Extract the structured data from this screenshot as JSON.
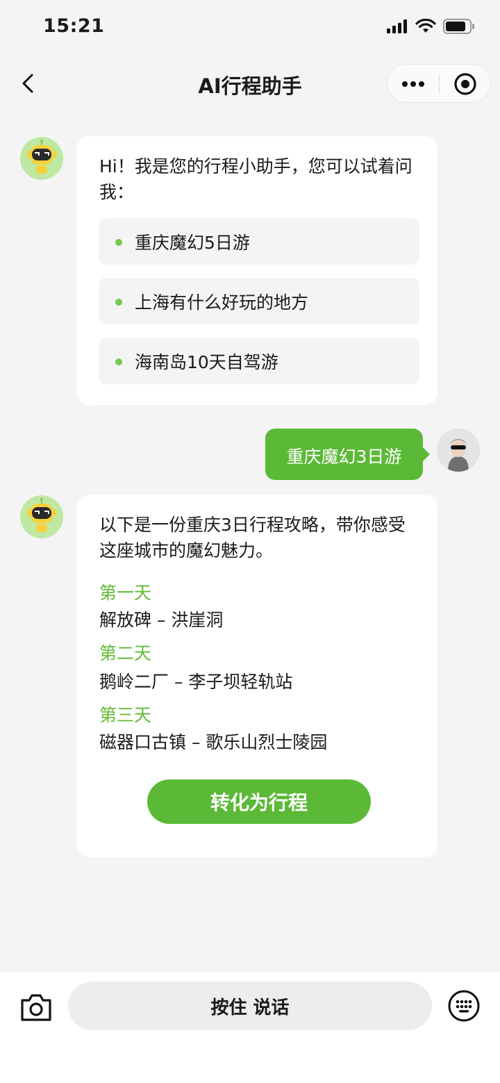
{
  "status_bar": {
    "time": "15:21"
  },
  "nav": {
    "title": "AI行程助手"
  },
  "greeting": {
    "text": "Hi！我是您的行程小助手，您可以试着问我：",
    "suggestions": [
      "重庆魔幻5日游",
      "上海有什么好玩的地方",
      "海南岛10天自驾游"
    ]
  },
  "user_message": {
    "text": "重庆魔幻3日游"
  },
  "reply": {
    "intro": "以下是一份重庆3日行程攻略，带你感受这座城市的魔幻魅力。",
    "days": [
      {
        "label": "第一天",
        "route": "解放碑 – 洪崖洞"
      },
      {
        "label": "第二天",
        "route": "鹅岭二厂 – 李子坝轻轨站"
      },
      {
        "label": "第三天",
        "route": "磁器口古镇 – 歌乐山烈士陵园"
      }
    ],
    "convert_button": "转化为行程"
  },
  "bottom_bar": {
    "hold_to_talk": "按住 说话"
  },
  "colors": {
    "accent": "#5cb937",
    "day_label": "#62bb38",
    "background": "#f4f4f4"
  },
  "icons": {
    "bot_avatar": "robot-avatar",
    "user_avatar": "user-avatar",
    "camera": "camera-icon",
    "keyboard": "keyboard-icon",
    "back": "chevron-left-icon",
    "more": "more-dots-icon",
    "close": "target-icon"
  }
}
